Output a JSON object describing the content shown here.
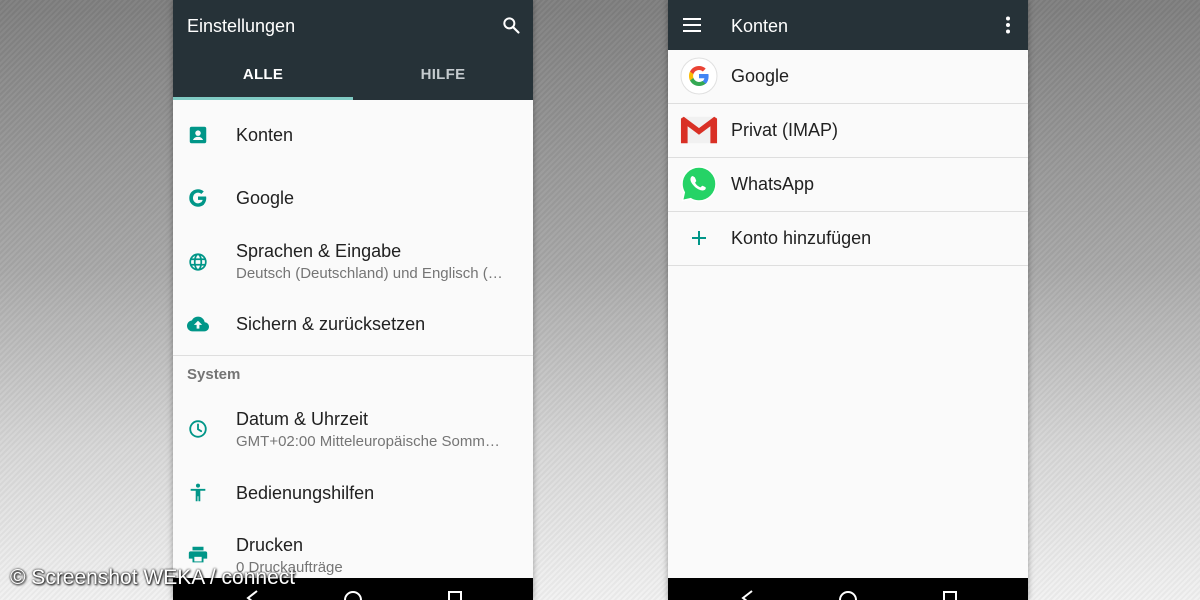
{
  "left_screen": {
    "title": "Einstellungen",
    "tabs": [
      {
        "label": "ALLE",
        "active": true
      },
      {
        "label": "HILFE",
        "active": false
      }
    ],
    "items": [
      {
        "title": "Konten",
        "subtitle": "",
        "icon": "account-box-icon"
      },
      {
        "title": "Google",
        "subtitle": "",
        "icon": "google-g-icon"
      },
      {
        "title": "Sprachen & Eingabe",
        "subtitle": "Deutsch (Deutschland) und Englisch (…",
        "icon": "globe-icon"
      },
      {
        "title": "Sichern & zurücksetzen",
        "subtitle": "",
        "icon": "cloud-upload-icon"
      }
    ],
    "section_system": "System",
    "system_items": [
      {
        "title": "Datum & Uhrzeit",
        "subtitle": "GMT+02:00 Mitteleuropäische Somm…",
        "icon": "clock-icon"
      },
      {
        "title": "Bedienungshilfen",
        "subtitle": "",
        "icon": "accessibility-icon"
      },
      {
        "title": "Drucken",
        "subtitle": "0 Druckaufträge",
        "icon": "printer-icon"
      }
    ]
  },
  "right_screen": {
    "title": "Konten",
    "accounts": [
      {
        "label": "Google",
        "icon": "google-logo-icon"
      },
      {
        "label": "Privat (IMAP)",
        "icon": "gmail-icon"
      },
      {
        "label": "WhatsApp",
        "icon": "whatsapp-icon"
      },
      {
        "label": "Konto hinzufügen",
        "icon": "plus-icon"
      }
    ]
  },
  "watermark": "© Screenshot WEKA / connect",
  "colors": {
    "appbar": "#263238",
    "accent": "#009688",
    "tab_indicator": "#80cbc4",
    "whatsapp": "#25d366",
    "gmail_red": "#d93025"
  }
}
